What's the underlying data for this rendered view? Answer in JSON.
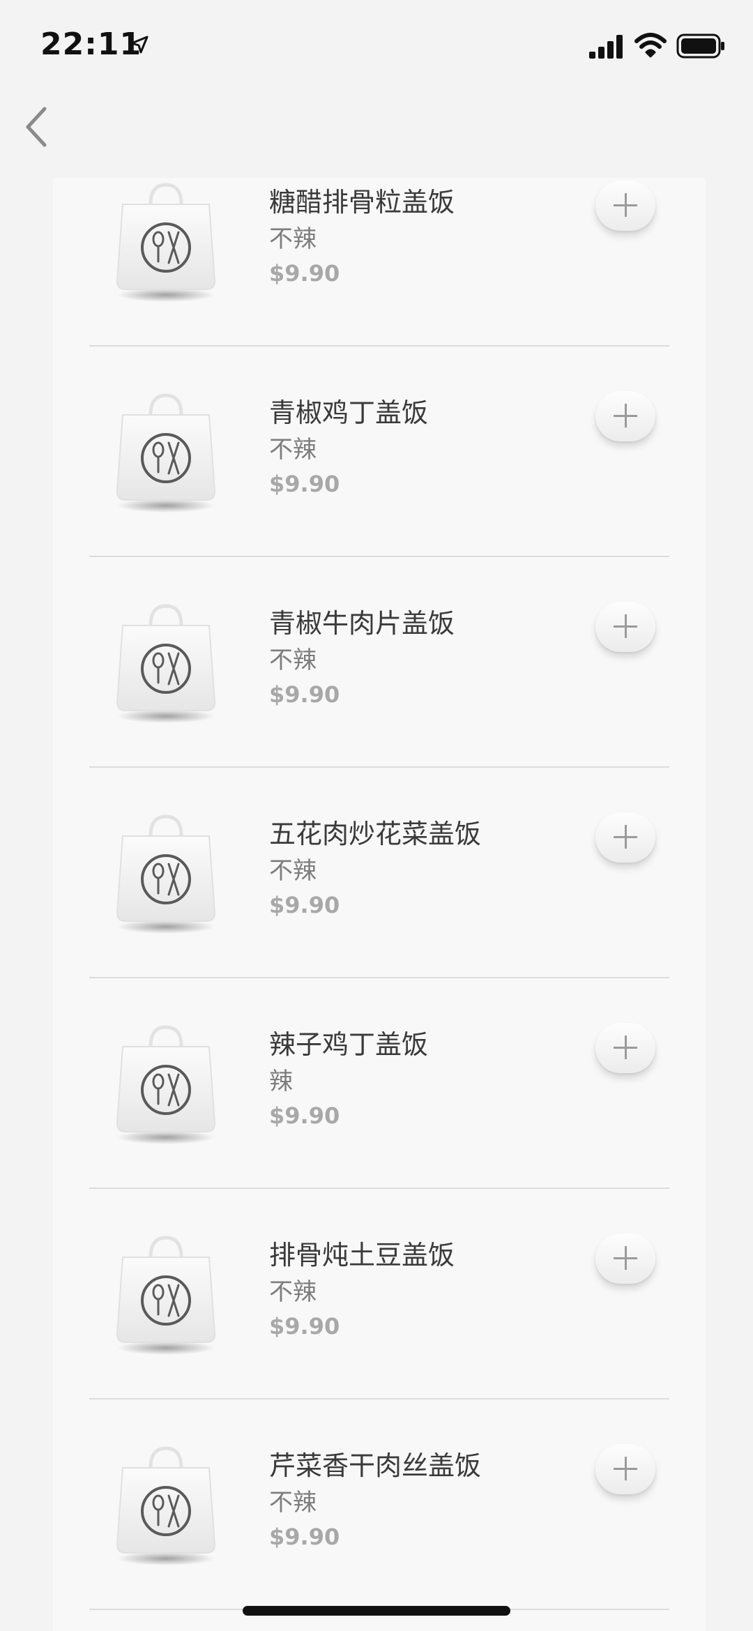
{
  "status_bar": {
    "time": "22:11",
    "location_icon": "location-arrow-icon",
    "signal_icon": "cellular-signal-icon",
    "wifi_icon": "wifi-icon",
    "battery_icon": "battery-icon"
  },
  "nav": {
    "back_icon": "chevron-left-icon"
  },
  "menu": {
    "item_icon": "shopping-bag-utensils-icon",
    "add_icon": "plus-icon",
    "items": [
      {
        "name": "糖醋排骨粒盖饭",
        "spice": "不辣",
        "price": "$9.90"
      },
      {
        "name": "青椒鸡丁盖饭",
        "spice": "不辣",
        "price": "$9.90"
      },
      {
        "name": "青椒牛肉片盖饭",
        "spice": "不辣",
        "price": "$9.90"
      },
      {
        "name": "五花肉炒花菜盖饭",
        "spice": "不辣",
        "price": "$9.90"
      },
      {
        "name": "辣子鸡丁盖饭",
        "spice": "辣",
        "price": "$9.90"
      },
      {
        "name": "排骨炖土豆盖饭",
        "spice": "不辣",
        "price": "$9.90"
      },
      {
        "name": "芹菜香干肉丝盖饭",
        "spice": "不辣",
        "price": "$9.90"
      }
    ]
  },
  "colors": {
    "background": "#f3f3f3",
    "card": "#f8f8f8",
    "name_text": "#3a3a3a",
    "spice_text": "#7d7d7d",
    "price_text": "#a8a8a8"
  }
}
